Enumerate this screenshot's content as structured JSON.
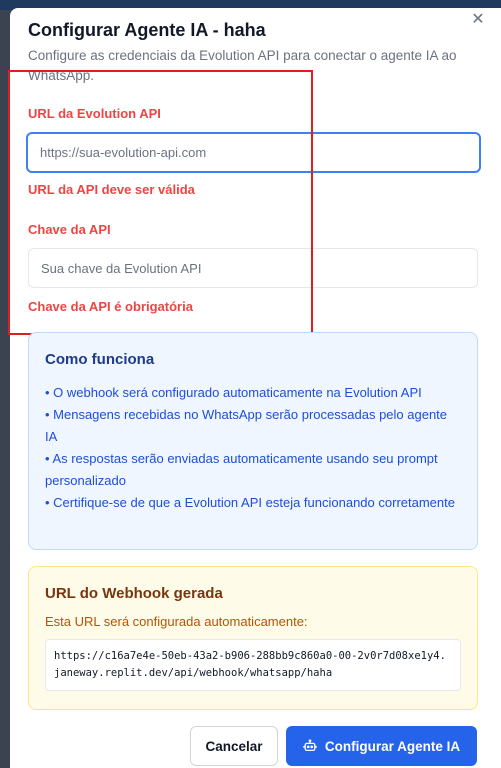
{
  "dialog": {
    "title": "Configurar Agente IA - haha",
    "subtitle": "Configure as credenciais da Evolution API para conectar o agente IA ao WhatsApp.",
    "close_icon": "close-icon"
  },
  "form": {
    "url": {
      "label": "URL da Evolution API",
      "placeholder": "https://sua-evolution-api.com",
      "value": "",
      "error": "URL da API deve ser válida"
    },
    "key": {
      "label": "Chave da API",
      "placeholder": "Sua chave da Evolution API",
      "value": "",
      "error": "Chave da API é obrigatória"
    }
  },
  "info": {
    "title": "Como funciona",
    "items": [
      "• O webhook será configurado automaticamente na Evolution API",
      "• Mensagens recebidas no WhatsApp serão processadas pelo agente IA",
      "• As respostas serão enviadas automaticamente usando seu prompt personalizado",
      "• Certifique-se de que a Evolution API esteja funcionando corretamente"
    ]
  },
  "webhook": {
    "title": "URL do Webhook gerada",
    "description": "Esta URL será configurada automaticamente:",
    "url": "https://c16a7e4e-50eb-43a2-b906-288bb9c860a0-00-2v0r7d08xe1y4.janeway.replit.dev/api/webhook/whatsapp/haha"
  },
  "actions": {
    "cancel_label": "Cancelar",
    "submit_label": "Configurar Agente IA",
    "submit_icon": "bot-icon"
  },
  "colors": {
    "accent": "#2563eb",
    "error": "#ef4444",
    "highlight": "#e11d1d"
  }
}
